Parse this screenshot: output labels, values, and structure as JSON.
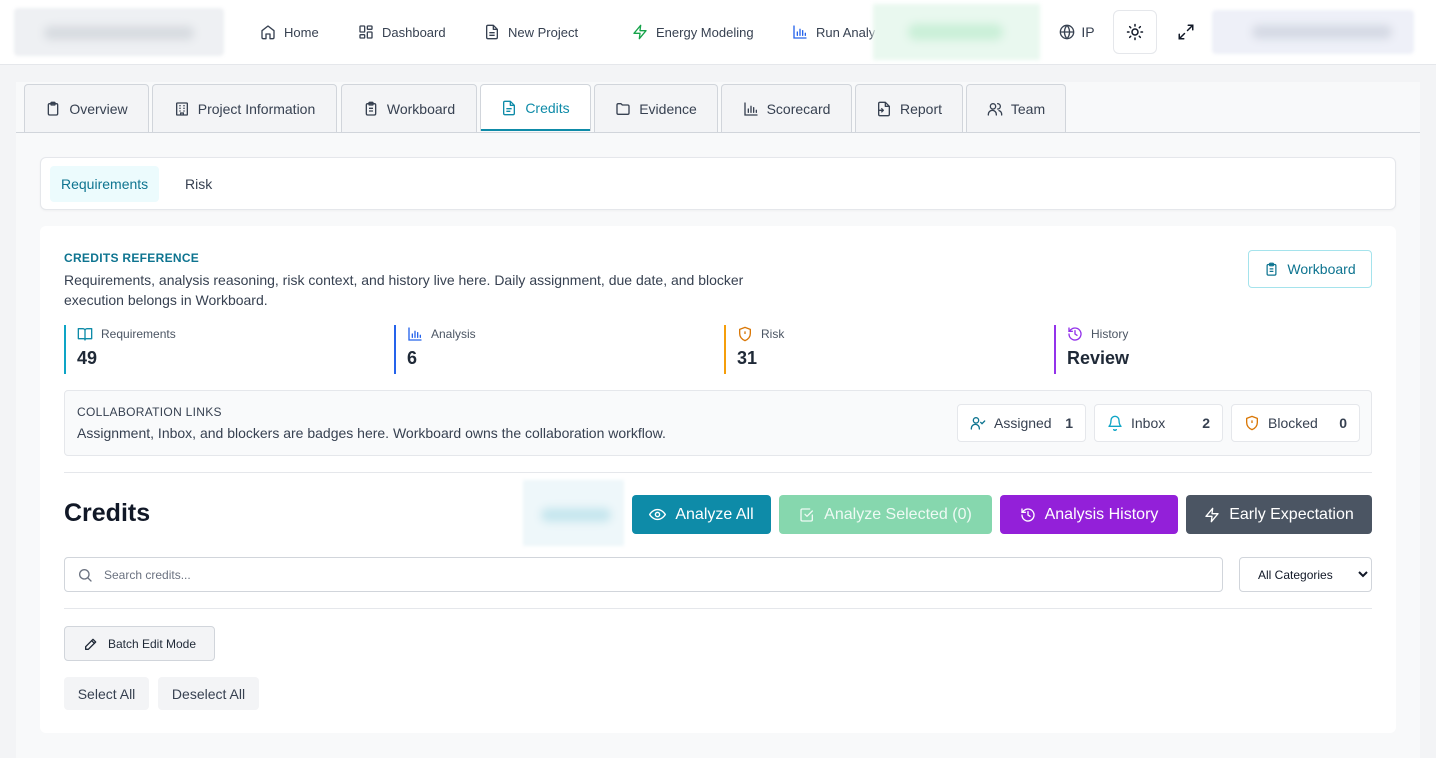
{
  "nav": {
    "items": [
      {
        "label": "Home",
        "icon": "home-icon"
      },
      {
        "label": "Dashboard",
        "icon": "dashboard-icon"
      },
      {
        "label": "New Project",
        "icon": "file-icon"
      },
      {
        "label": "Energy Modeling",
        "icon": "bolt-icon",
        "icon_color": "#16a34a"
      },
      {
        "label": "Run Analy",
        "icon": "chart-icon",
        "icon_color": "#2563eb"
      }
    ],
    "language_label": "IP"
  },
  "tabs": [
    {
      "label": "Overview",
      "icon": "clipboard-icon"
    },
    {
      "label": "Project Information",
      "icon": "building-icon"
    },
    {
      "label": "Workboard",
      "icon": "clipboard-list-icon"
    },
    {
      "label": "Credits",
      "icon": "document-icon",
      "active": true
    },
    {
      "label": "Evidence",
      "icon": "folder-icon"
    },
    {
      "label": "Scorecard",
      "icon": "bar-chart-icon"
    },
    {
      "label": "Report",
      "icon": "report-icon"
    },
    {
      "label": "Team",
      "icon": "users-icon"
    }
  ],
  "subtabs": [
    {
      "label": "Requirements",
      "active": true
    },
    {
      "label": "Risk"
    }
  ],
  "reference": {
    "eyebrow": "CREDITS REFERENCE",
    "description": "Requirements, analysis reasoning, risk context, and history live here. Daily assignment, due date, and blocker execution belongs in Workboard.",
    "workboard_button": "Workboard"
  },
  "stats": [
    {
      "label": "Requirements",
      "value": "49",
      "color": "#0ea5c6",
      "icon": "book-icon"
    },
    {
      "label": "Analysis",
      "value": "6",
      "color": "#2563eb",
      "icon": "bar-chart-icon"
    },
    {
      "label": "Risk",
      "value": "31",
      "color": "#f59e0b",
      "icon": "shield-icon"
    },
    {
      "label": "History",
      "value": "Review",
      "color": "#9333ea",
      "icon": "history-icon"
    }
  ],
  "collaboration": {
    "eyebrow": "COLLABORATION LINKS",
    "description": "Assignment, Inbox, and blockers are badges here. Workboard owns the collaboration workflow.",
    "badges": [
      {
        "label": "Assigned",
        "count": "1",
        "icon": "user-check-icon",
        "color": "#0e7490"
      },
      {
        "label": "Inbox",
        "count": "2",
        "icon": "bell-icon",
        "color": "#0ea5c6"
      },
      {
        "label": "Blocked",
        "count": "0",
        "icon": "shield-icon",
        "color": "#d97706"
      }
    ]
  },
  "credits": {
    "title": "Credits",
    "buttons": {
      "analyze_all": "Analyze All",
      "analyze_selected": "Analyze Selected (0)",
      "analysis_history": "Analysis History",
      "early_expectation": "Early Expectation"
    },
    "colors": {
      "analyze_all": "#0e8ba8",
      "analyze_selected": "#86d7ae",
      "analysis_history": "#9320d9",
      "early_expectation": "#4b5563"
    },
    "search_placeholder": "Search credits...",
    "category_selected": "All Categories",
    "batch_edit": "Batch Edit Mode",
    "select_all": "Select All",
    "deselect_all": "Deselect All"
  }
}
